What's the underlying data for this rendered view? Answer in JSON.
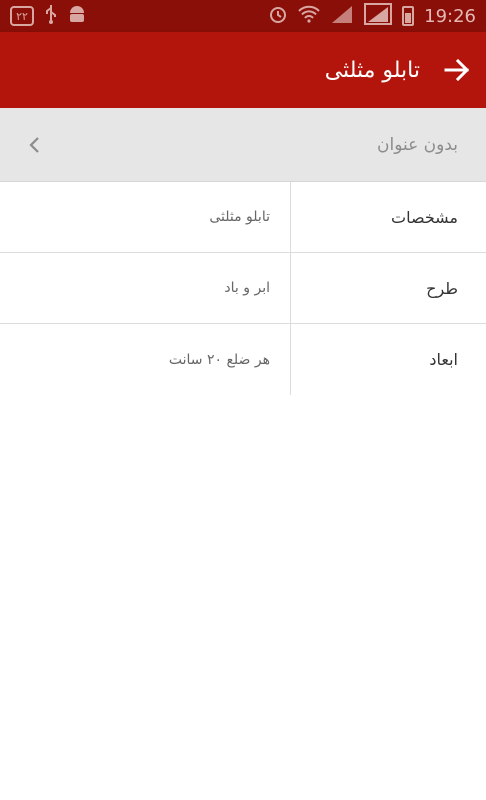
{
  "status_bar": {
    "time": "19:26",
    "badge": "۲۲",
    "icons": [
      "calendar-badge-icon",
      "usb-icon",
      "android-icon",
      "alarm-icon",
      "wifi-icon",
      "signal-icon",
      "signal-icon",
      "battery-icon"
    ]
  },
  "app_bar": {
    "title": "تابلو مثلثی",
    "back_icon": "arrow-right-icon"
  },
  "section": {
    "title": "بدون عنوان",
    "chevron_icon": "chevron-left-icon"
  },
  "specs": [
    {
      "label": "مشخصات",
      "value": "تابلو مثلثی"
    },
    {
      "label": "طرح",
      "value": "ابر و باد"
    },
    {
      "label": "ابعاد",
      "value": "هر ضلع ۲۰ سانت"
    }
  ],
  "colors": {
    "status_bar": "#8a0f08",
    "app_bar": "#b3150c",
    "section_header": "#e6e6e6"
  }
}
